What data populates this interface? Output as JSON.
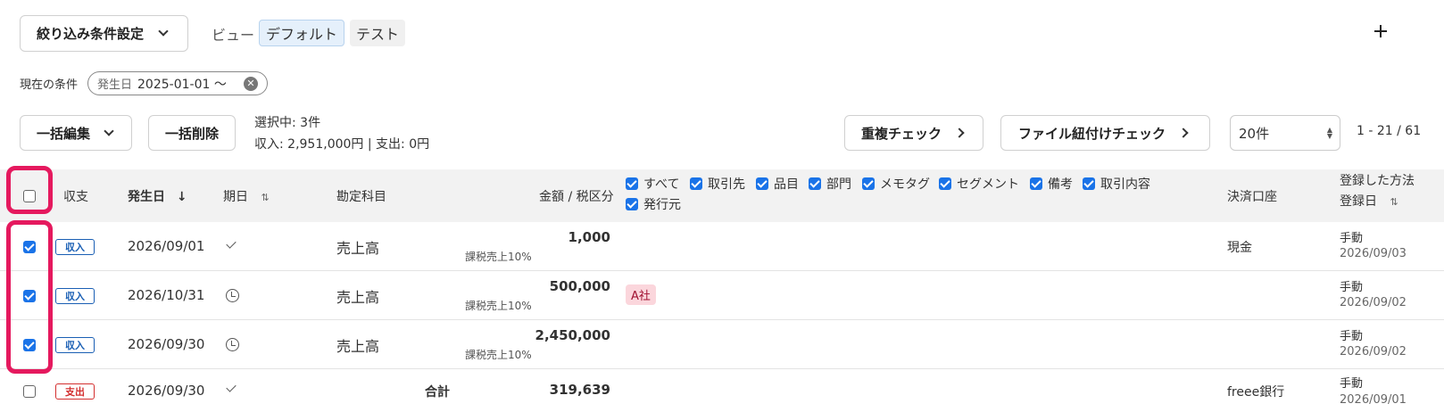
{
  "toolbar": {
    "filter_button": "絞り込み条件設定",
    "view_label": "ビュー",
    "views": [
      "デフォルト",
      "テスト"
    ],
    "add_icon": "plus-icon"
  },
  "conditions": {
    "label": "現在の条件",
    "chip_label": "発生日",
    "chip_value": "2025-01-01 〜"
  },
  "actions": {
    "bulk_edit": "一括編集",
    "bulk_delete": "一括削除",
    "selected_text": "選択中: 3件",
    "summary_text": "収入: 2,951,000円 | 支出: 0円",
    "duplicate_check": "重複チェック",
    "file_check": "ファイル紐付けチェック",
    "per_page": "20件",
    "range": "1 - 21 / 61"
  },
  "columns": {
    "type": "収支",
    "date": "発生日",
    "due": "期日",
    "account": "勘定科目",
    "amount": "金額 / 税区分",
    "tags": [
      "すべて",
      "取引先",
      "品目",
      "部門",
      "メモタグ",
      "セグメント",
      "備考",
      "取引内容",
      "発行元"
    ],
    "wallet": "決済口座",
    "method": "登録した方法",
    "registered": "登録日"
  },
  "rows": [
    {
      "checked": true,
      "type": "収入",
      "date": "2026/09/01",
      "due_icon": "check-icon",
      "account": "売上高",
      "amount": "1,000",
      "tax": "課税売上10%",
      "tag": "",
      "wallet": "現金",
      "method": "手動",
      "registered": "2026/09/03"
    },
    {
      "checked": true,
      "type": "収入",
      "date": "2026/10/31",
      "due_icon": "clock-icon",
      "account": "売上高",
      "amount": "500,000",
      "tax": "課税売上10%",
      "tag": "A社",
      "wallet": "",
      "method": "手動",
      "registered": "2026/09/02"
    },
    {
      "checked": true,
      "type": "収入",
      "date": "2026/09/30",
      "due_icon": "clock-icon",
      "account": "売上高",
      "amount": "2,450,000",
      "tax": "課税売上10%",
      "tag": "",
      "wallet": "",
      "method": "手動",
      "registered": "2026/09/02"
    },
    {
      "checked": false,
      "type": "支出",
      "date": "2026/09/30",
      "due_icon": "check-icon",
      "account": "合計",
      "amount": "319,639",
      "tax": "",
      "tag": "",
      "wallet": "freee銀行",
      "method": "手動",
      "registered": "2026/09/01"
    }
  ],
  "colors": {
    "highlight": "#e5195e",
    "income": "#1a5fb4",
    "expense": "#d32f2f",
    "checkbox": "#1a73e8"
  }
}
